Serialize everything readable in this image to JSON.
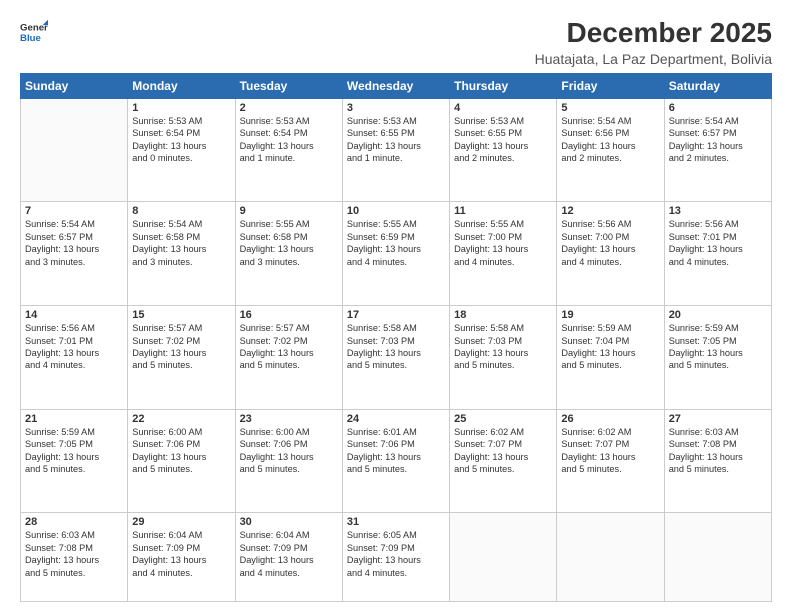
{
  "logo": {
    "line1": "General",
    "line2": "Blue"
  },
  "title": "December 2025",
  "subtitle": "Huatajata, La Paz Department, Bolivia",
  "weekdays": [
    "Sunday",
    "Monday",
    "Tuesday",
    "Wednesday",
    "Thursday",
    "Friday",
    "Saturday"
  ],
  "weeks": [
    [
      {
        "day": "",
        "info": ""
      },
      {
        "day": "1",
        "info": "Sunrise: 5:53 AM\nSunset: 6:54 PM\nDaylight: 13 hours\nand 0 minutes."
      },
      {
        "day": "2",
        "info": "Sunrise: 5:53 AM\nSunset: 6:54 PM\nDaylight: 13 hours\nand 1 minute."
      },
      {
        "day": "3",
        "info": "Sunrise: 5:53 AM\nSunset: 6:55 PM\nDaylight: 13 hours\nand 1 minute."
      },
      {
        "day": "4",
        "info": "Sunrise: 5:53 AM\nSunset: 6:55 PM\nDaylight: 13 hours\nand 2 minutes."
      },
      {
        "day": "5",
        "info": "Sunrise: 5:54 AM\nSunset: 6:56 PM\nDaylight: 13 hours\nand 2 minutes."
      },
      {
        "day": "6",
        "info": "Sunrise: 5:54 AM\nSunset: 6:57 PM\nDaylight: 13 hours\nand 2 minutes."
      }
    ],
    [
      {
        "day": "7",
        "info": "Sunrise: 5:54 AM\nSunset: 6:57 PM\nDaylight: 13 hours\nand 3 minutes."
      },
      {
        "day": "8",
        "info": "Sunrise: 5:54 AM\nSunset: 6:58 PM\nDaylight: 13 hours\nand 3 minutes."
      },
      {
        "day": "9",
        "info": "Sunrise: 5:55 AM\nSunset: 6:58 PM\nDaylight: 13 hours\nand 3 minutes."
      },
      {
        "day": "10",
        "info": "Sunrise: 5:55 AM\nSunset: 6:59 PM\nDaylight: 13 hours\nand 4 minutes."
      },
      {
        "day": "11",
        "info": "Sunrise: 5:55 AM\nSunset: 7:00 PM\nDaylight: 13 hours\nand 4 minutes."
      },
      {
        "day": "12",
        "info": "Sunrise: 5:56 AM\nSunset: 7:00 PM\nDaylight: 13 hours\nand 4 minutes."
      },
      {
        "day": "13",
        "info": "Sunrise: 5:56 AM\nSunset: 7:01 PM\nDaylight: 13 hours\nand 4 minutes."
      }
    ],
    [
      {
        "day": "14",
        "info": "Sunrise: 5:56 AM\nSunset: 7:01 PM\nDaylight: 13 hours\nand 4 minutes."
      },
      {
        "day": "15",
        "info": "Sunrise: 5:57 AM\nSunset: 7:02 PM\nDaylight: 13 hours\nand 5 minutes."
      },
      {
        "day": "16",
        "info": "Sunrise: 5:57 AM\nSunset: 7:02 PM\nDaylight: 13 hours\nand 5 minutes."
      },
      {
        "day": "17",
        "info": "Sunrise: 5:58 AM\nSunset: 7:03 PM\nDaylight: 13 hours\nand 5 minutes."
      },
      {
        "day": "18",
        "info": "Sunrise: 5:58 AM\nSunset: 7:03 PM\nDaylight: 13 hours\nand 5 minutes."
      },
      {
        "day": "19",
        "info": "Sunrise: 5:59 AM\nSunset: 7:04 PM\nDaylight: 13 hours\nand 5 minutes."
      },
      {
        "day": "20",
        "info": "Sunrise: 5:59 AM\nSunset: 7:05 PM\nDaylight: 13 hours\nand 5 minutes."
      }
    ],
    [
      {
        "day": "21",
        "info": "Sunrise: 5:59 AM\nSunset: 7:05 PM\nDaylight: 13 hours\nand 5 minutes."
      },
      {
        "day": "22",
        "info": "Sunrise: 6:00 AM\nSunset: 7:06 PM\nDaylight: 13 hours\nand 5 minutes."
      },
      {
        "day": "23",
        "info": "Sunrise: 6:00 AM\nSunset: 7:06 PM\nDaylight: 13 hours\nand 5 minutes."
      },
      {
        "day": "24",
        "info": "Sunrise: 6:01 AM\nSunset: 7:06 PM\nDaylight: 13 hours\nand 5 minutes."
      },
      {
        "day": "25",
        "info": "Sunrise: 6:02 AM\nSunset: 7:07 PM\nDaylight: 13 hours\nand 5 minutes."
      },
      {
        "day": "26",
        "info": "Sunrise: 6:02 AM\nSunset: 7:07 PM\nDaylight: 13 hours\nand 5 minutes."
      },
      {
        "day": "27",
        "info": "Sunrise: 6:03 AM\nSunset: 7:08 PM\nDaylight: 13 hours\nand 5 minutes."
      }
    ],
    [
      {
        "day": "28",
        "info": "Sunrise: 6:03 AM\nSunset: 7:08 PM\nDaylight: 13 hours\nand 5 minutes."
      },
      {
        "day": "29",
        "info": "Sunrise: 6:04 AM\nSunset: 7:09 PM\nDaylight: 13 hours\nand 4 minutes."
      },
      {
        "day": "30",
        "info": "Sunrise: 6:04 AM\nSunset: 7:09 PM\nDaylight: 13 hours\nand 4 minutes."
      },
      {
        "day": "31",
        "info": "Sunrise: 6:05 AM\nSunset: 7:09 PM\nDaylight: 13 hours\nand 4 minutes."
      },
      {
        "day": "",
        "info": ""
      },
      {
        "day": "",
        "info": ""
      },
      {
        "day": "",
        "info": ""
      }
    ]
  ]
}
